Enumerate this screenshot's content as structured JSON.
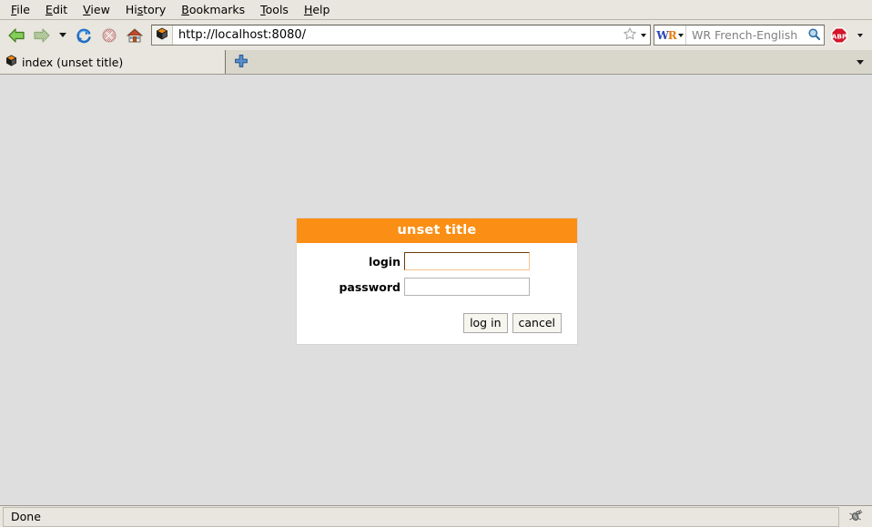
{
  "window": {
    "title": "index (unset title)"
  },
  "menubar": {
    "items": [
      {
        "label": "File",
        "accel": "F"
      },
      {
        "label": "Edit",
        "accel": "E"
      },
      {
        "label": "View",
        "accel": "V"
      },
      {
        "label": "History",
        "accel": "s"
      },
      {
        "label": "Bookmarks",
        "accel": "B"
      },
      {
        "label": "Tools",
        "accel": "T"
      },
      {
        "label": "Help",
        "accel": "H"
      }
    ]
  },
  "toolbar": {
    "back_icon": "back-arrow-icon",
    "forward_icon": "forward-arrow-icon",
    "history_dropdown_icon": "chevron-down-icon",
    "reload_icon": "reload-icon",
    "stop_icon": "stop-icon",
    "home_icon": "home-icon",
    "site_identity_icon": "cube-favicon",
    "bookmark_star_icon": "star-icon",
    "url_dropdown_icon": "chevron-down-icon",
    "adblock_icon": "adblock-plus-icon",
    "adblock_dropdown_icon": "chevron-down-icon"
  },
  "address": {
    "url": "http://localhost:8080/"
  },
  "search": {
    "engine_label": "WR",
    "engine_dropdown_icon": "chevron-down-icon",
    "placeholder": "WR French-English",
    "value": "",
    "go_icon": "magnifier-icon"
  },
  "tabs": {
    "items": [
      {
        "label": "index (unset title)",
        "icon": "cube-favicon",
        "active": true
      }
    ],
    "new_tab_icon": "plus-icon",
    "list_all_tabs_icon": "chevron-down-icon"
  },
  "page": {
    "login_form": {
      "title": "unset title",
      "fields": [
        {
          "label": "login",
          "value": "",
          "type": "text",
          "focused": true
        },
        {
          "label": "password",
          "value": "",
          "type": "password",
          "focused": false
        }
      ],
      "buttons": [
        {
          "label": "log in",
          "name": "log-in-button"
        },
        {
          "label": "cancel",
          "name": "cancel-button"
        }
      ]
    }
  },
  "statusbar": {
    "message": "Done",
    "firebug_icon": "firebug-bug-icon"
  },
  "colors": {
    "accent_orange": "#fb8e14",
    "page_background": "#dededf",
    "chrome_background": "#e8e6de",
    "focused_border": "#6b3d06"
  }
}
